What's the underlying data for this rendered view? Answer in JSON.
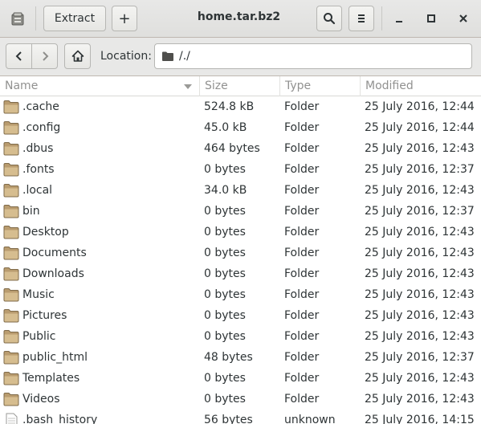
{
  "window": {
    "title": "home.tar.bz2",
    "extract_label": "Extract",
    "add_label": "+",
    "minimize_glyph": "—",
    "maximize_glyph": "◻",
    "close_glyph": "✕"
  },
  "toolbar": {
    "location_label": "Location:",
    "location_value": "/./"
  },
  "columns": [
    "Name",
    "Size",
    "Type",
    "Modified"
  ],
  "files": [
    {
      "name": ".cache",
      "size": "524.8 kB",
      "type": "Folder",
      "modified": "25 July 2016, 12:44",
      "icon": "folder-icon"
    },
    {
      "name": ".config",
      "size": "45.0 kB",
      "type": "Folder",
      "modified": "25 July 2016, 12:44",
      "icon": "folder-icon"
    },
    {
      "name": ".dbus",
      "size": "464 bytes",
      "type": "Folder",
      "modified": "25 July 2016, 12:43",
      "icon": "folder-icon"
    },
    {
      "name": ".fonts",
      "size": "0 bytes",
      "type": "Folder",
      "modified": "25 July 2016, 12:37",
      "icon": "folder-icon"
    },
    {
      "name": ".local",
      "size": "34.0 kB",
      "type": "Folder",
      "modified": "25 July 2016, 12:43",
      "icon": "folder-icon"
    },
    {
      "name": "bin",
      "size": "0 bytes",
      "type": "Folder",
      "modified": "25 July 2016, 12:37",
      "icon": "folder-icon"
    },
    {
      "name": "Desktop",
      "size": "0 bytes",
      "type": "Folder",
      "modified": "25 July 2016, 12:43",
      "icon": "folder-icon"
    },
    {
      "name": "Documents",
      "size": "0 bytes",
      "type": "Folder",
      "modified": "25 July 2016, 12:43",
      "icon": "folder-icon"
    },
    {
      "name": "Downloads",
      "size": "0 bytes",
      "type": "Folder",
      "modified": "25 July 2016, 12:43",
      "icon": "folder-icon"
    },
    {
      "name": "Music",
      "size": "0 bytes",
      "type": "Folder",
      "modified": "25 July 2016, 12:43",
      "icon": "folder-icon"
    },
    {
      "name": "Pictures",
      "size": "0 bytes",
      "type": "Folder",
      "modified": "25 July 2016, 12:43",
      "icon": "folder-icon"
    },
    {
      "name": "Public",
      "size": "0 bytes",
      "type": "Folder",
      "modified": "25 July 2016, 12:43",
      "icon": "folder-icon"
    },
    {
      "name": "public_html",
      "size": "48 bytes",
      "type": "Folder",
      "modified": "25 July 2016, 12:37",
      "icon": "folder-icon"
    },
    {
      "name": "Templates",
      "size": "0 bytes",
      "type": "Folder",
      "modified": "25 July 2016, 12:43",
      "icon": "folder-icon"
    },
    {
      "name": "Videos",
      "size": "0 bytes",
      "type": "Folder",
      "modified": "25 July 2016, 12:43",
      "icon": "folder-icon"
    },
    {
      "name": ".bash_history",
      "size": "56 bytes",
      "type": "unknown",
      "modified": "25 July 2016, 14:15",
      "icon": "file-icon"
    }
  ]
}
